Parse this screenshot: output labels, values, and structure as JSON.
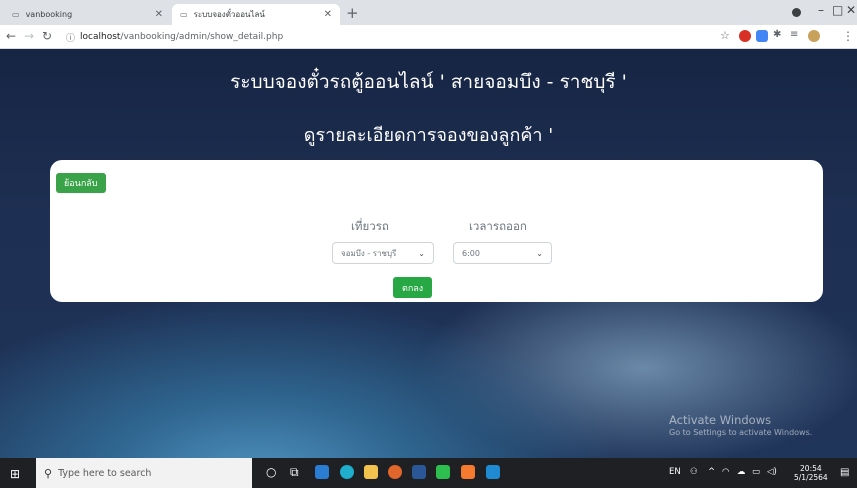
{
  "browser": {
    "tabs": [
      {
        "title": "vanbooking",
        "active": false
      },
      {
        "title": "ระบบจองตั๋วออนไลน์",
        "active": true
      }
    ],
    "new_tab": "+",
    "address_host": "localhost",
    "address_path": "/vanbooking/admin/show_detail.php"
  },
  "page": {
    "title": "ระบบจองตั๋วรถตู้ออนไลน์ ' สายจอมบึง - ราชบุรี '",
    "subtitle": "ดูรายละเอียดการจองของลูกค้า '",
    "back_button": "ย้อนกลับ",
    "route_label": "เที่ยวรถ",
    "route_selected": "จอมบึง - ราชบุรี",
    "time_label": "เวลารถออก",
    "time_selected": "6:00",
    "submit_button": "ตกลง"
  },
  "watermark": {
    "line1": "Activate Windows",
    "line2": "Go to Settings to activate Windows."
  },
  "taskbar": {
    "search_placeholder": "Type here to search",
    "lang": "EN",
    "time": "20:54",
    "date": "5/1/2564"
  },
  "colors": {
    "accent_green": "#3aa34a",
    "submit_green": "#28a745",
    "page_bg": "#1b2b4a"
  }
}
